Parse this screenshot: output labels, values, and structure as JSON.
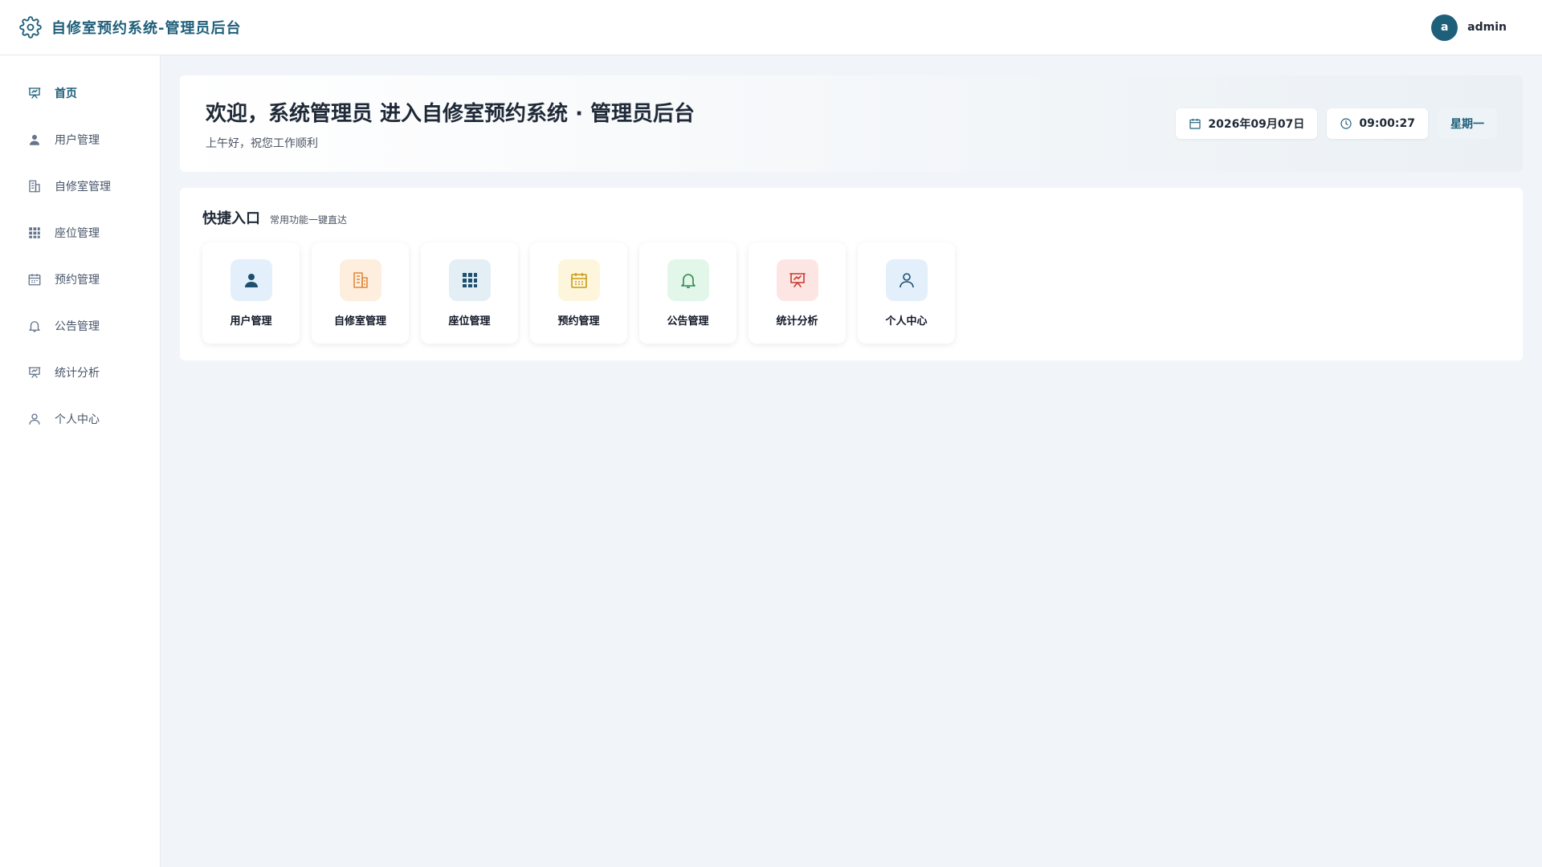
{
  "app": {
    "title": "自修室预约系统-管理员后台",
    "brand_icon": "gear-icon"
  },
  "user": {
    "avatar_letter": "a",
    "name": "admin"
  },
  "sidebar": {
    "items": [
      {
        "label": "首页",
        "icon": "presentation-chart-icon",
        "active": true
      },
      {
        "label": "用户管理",
        "icon": "user-icon"
      },
      {
        "label": "自修室管理",
        "icon": "building-icon"
      },
      {
        "label": "座位管理",
        "icon": "grid-icon"
      },
      {
        "label": "预约管理",
        "icon": "calendar-icon"
      },
      {
        "label": "公告管理",
        "icon": "bell-icon"
      },
      {
        "label": "统计分析",
        "icon": "presentation-chart-icon"
      },
      {
        "label": "个人中心",
        "icon": "user-outline-icon"
      }
    ]
  },
  "welcome": {
    "title": "欢迎，系统管理员 进入自修室预约系统 · 管理员后台",
    "subtitle": "上午好，祝您工作顺利",
    "date": "2026年09月07日",
    "time": "09:00:27",
    "weekday": "星期一"
  },
  "quick": {
    "title": "快捷入口",
    "subtitle": "常用功能一键直达",
    "cards": [
      {
        "label": "用户管理",
        "icon": "user-icon",
        "bg": "#e3f0fb",
        "color": "#1e4f6e"
      },
      {
        "label": "自修室管理",
        "icon": "building-icon",
        "bg": "#fdeedd",
        "color": "#e08a3c"
      },
      {
        "label": "座位管理",
        "icon": "grid-icon",
        "bg": "#e3eef5",
        "color": "#1e4f6e"
      },
      {
        "label": "预约管理",
        "icon": "calendar-icon",
        "bg": "#fdf6dc",
        "color": "#c99a12"
      },
      {
        "label": "公告管理",
        "icon": "bell-icon",
        "bg": "#e2f6ea",
        "color": "#2f8a4e"
      },
      {
        "label": "统计分析",
        "icon": "presentation-chart-icon",
        "bg": "#fde5e3",
        "color": "#c83a2f"
      },
      {
        "label": "个人中心",
        "icon": "user-outline-icon",
        "bg": "#e3f0fb",
        "color": "#1e4f6e"
      }
    ]
  },
  "colors": {
    "accent": "#1e5f7a",
    "background": "#f1f5f9"
  }
}
